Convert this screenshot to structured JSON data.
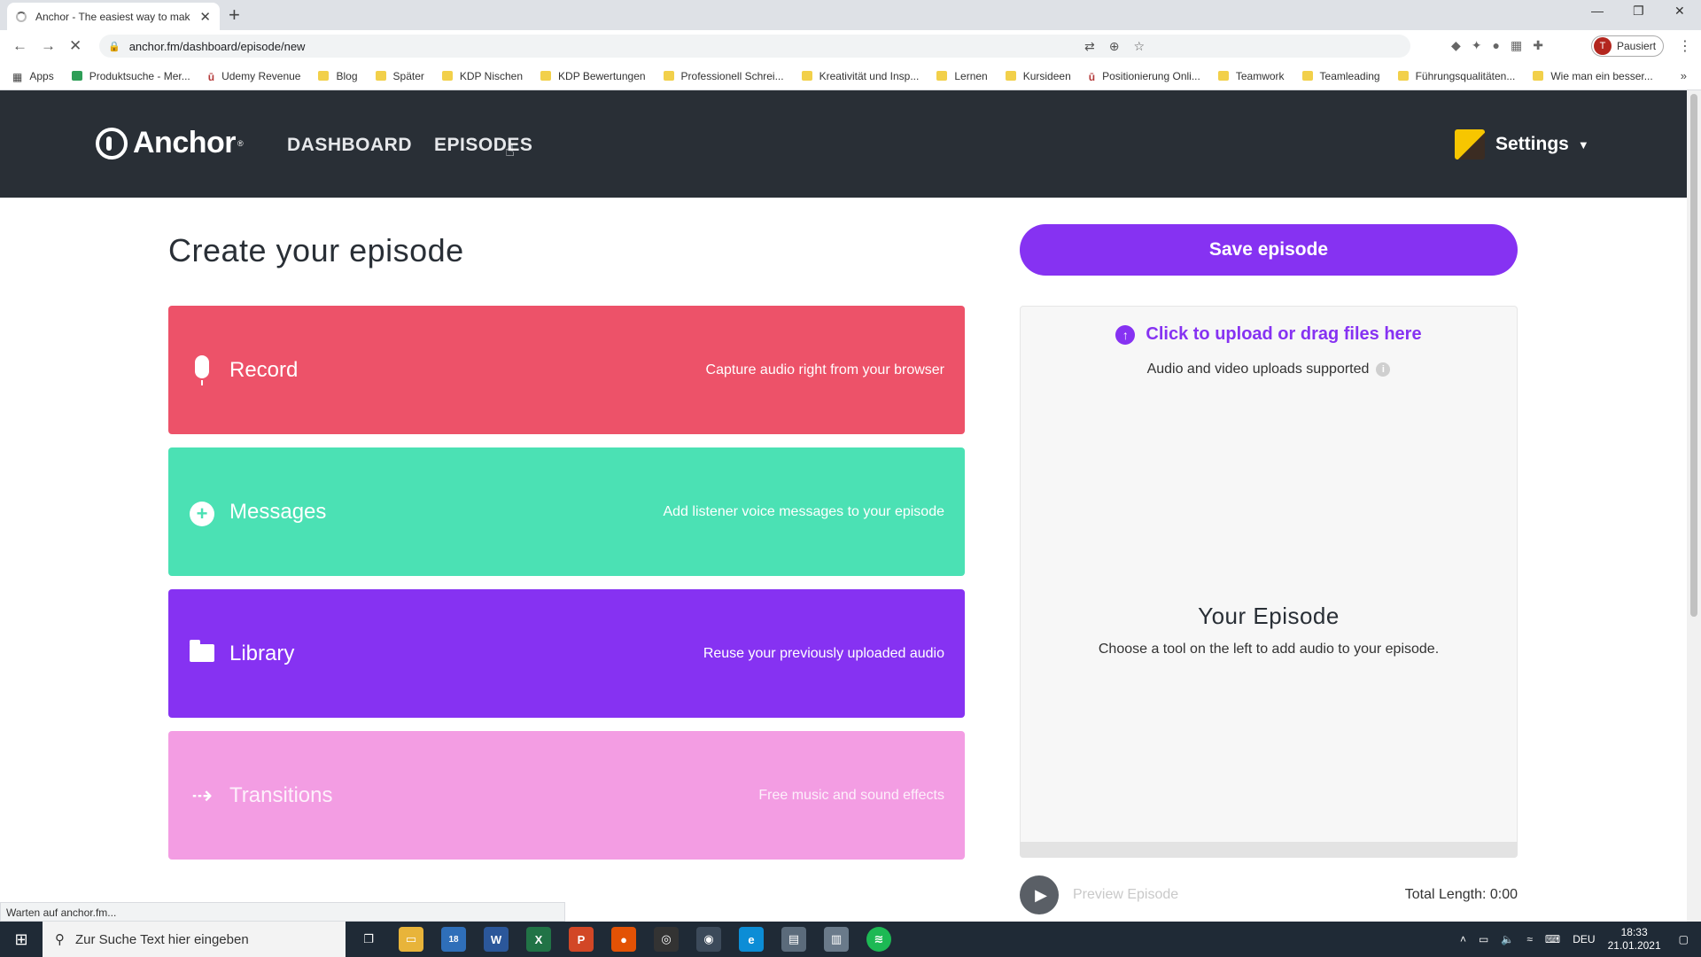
{
  "browser": {
    "tab_title": "Anchor - The easiest way to mak",
    "new_tab": "+",
    "url": "anchor.fm/dashboard/episode/new",
    "profile_initial": "T",
    "profile_label": "Pausiert",
    "bookmarks": [
      {
        "label": "Apps",
        "icon": "apps-icon"
      },
      {
        "label": "Produktsuche - Mer...",
        "icon": "green-icon"
      },
      {
        "label": "Udemy Revenue",
        "icon": "udemy-icon"
      },
      {
        "label": "Blog",
        "icon": "folder-icon"
      },
      {
        "label": "Später",
        "icon": "folder-icon"
      },
      {
        "label": "KDP Nischen",
        "icon": "folder-icon"
      },
      {
        "label": "KDP Bewertungen",
        "icon": "folder-icon"
      },
      {
        "label": "Professionell Schrei...",
        "icon": "folder-icon"
      },
      {
        "label": "Kreativität und Insp...",
        "icon": "folder-icon"
      },
      {
        "label": "Lernen",
        "icon": "folder-icon"
      },
      {
        "label": "Kursideen",
        "icon": "folder-icon"
      },
      {
        "label": "Positionierung Onli...",
        "icon": "udemy-icon"
      },
      {
        "label": "Teamwork",
        "icon": "folder-icon"
      },
      {
        "label": "Teamleading",
        "icon": "folder-icon"
      },
      {
        "label": "Führungsqualitäten...",
        "icon": "folder-icon"
      },
      {
        "label": "Wie man ein besser...",
        "icon": "folder-icon"
      }
    ],
    "bookmarks_more": "»",
    "status_text": "Warten auf anchor.fm..."
  },
  "header": {
    "logo_text": "Anchor",
    "logo_reg": "®",
    "nav": [
      {
        "label": "DASHBOARD"
      },
      {
        "label": "EPISODES"
      }
    ],
    "settings_label": "Settings"
  },
  "main": {
    "title": "Create your episode",
    "tools": [
      {
        "name": "Record",
        "desc": "Capture audio right from your browser",
        "color": "#ed5269"
      },
      {
        "name": "Messages",
        "desc": "Add listener voice messages to your episode",
        "color": "#4be1b4"
      },
      {
        "name": "Library",
        "desc": "Reuse your previously uploaded audio",
        "color": "#8632f2"
      },
      {
        "name": "Transitions",
        "desc": "Free music and sound effects",
        "color": "#f39de3"
      }
    ]
  },
  "panel": {
    "save_label": "Save episode",
    "upload_label": "Click to upload or drag files here",
    "support_label": "Audio and video uploads supported",
    "episode_title": "Your Episode",
    "episode_sub": "Choose a tool on the left to add audio to your episode.",
    "preview_label": "Preview Episode",
    "total_length": "Total Length: 0:00"
  },
  "taskbar": {
    "search_placeholder": "Zur Suche Text hier eingeben",
    "mail_badge": "18",
    "lang": "DEU",
    "time": "18:33",
    "date": "21.01.2021"
  },
  "colors": {
    "accent": "#8632f2",
    "header_bg": "#292f36"
  }
}
